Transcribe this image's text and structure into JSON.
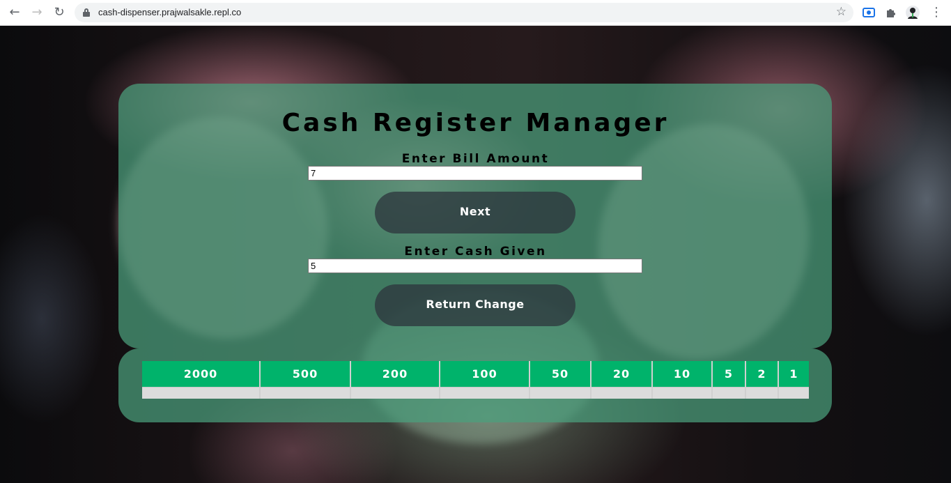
{
  "browser": {
    "url": "cash-dispenser.prajwalsakle.repl.co",
    "back_icon": "←",
    "forward_icon": "→",
    "reload_icon": "↻",
    "star_icon": "☆",
    "menu_icon": "⋮"
  },
  "app": {
    "title": "Cash Register Manager",
    "bill_label": "Enter Bill Amount",
    "bill_value": "7",
    "next_label": "Next",
    "cash_label": "Enter Cash Given",
    "cash_value": "5",
    "return_label": "Return Change"
  },
  "denominations": [
    "2000",
    "500",
    "200",
    "100",
    "50",
    "20",
    "10",
    "5",
    "2",
    "1"
  ],
  "colors": {
    "accent": "#00b36b",
    "card": "#4ba07d",
    "button": "#2d373e"
  }
}
